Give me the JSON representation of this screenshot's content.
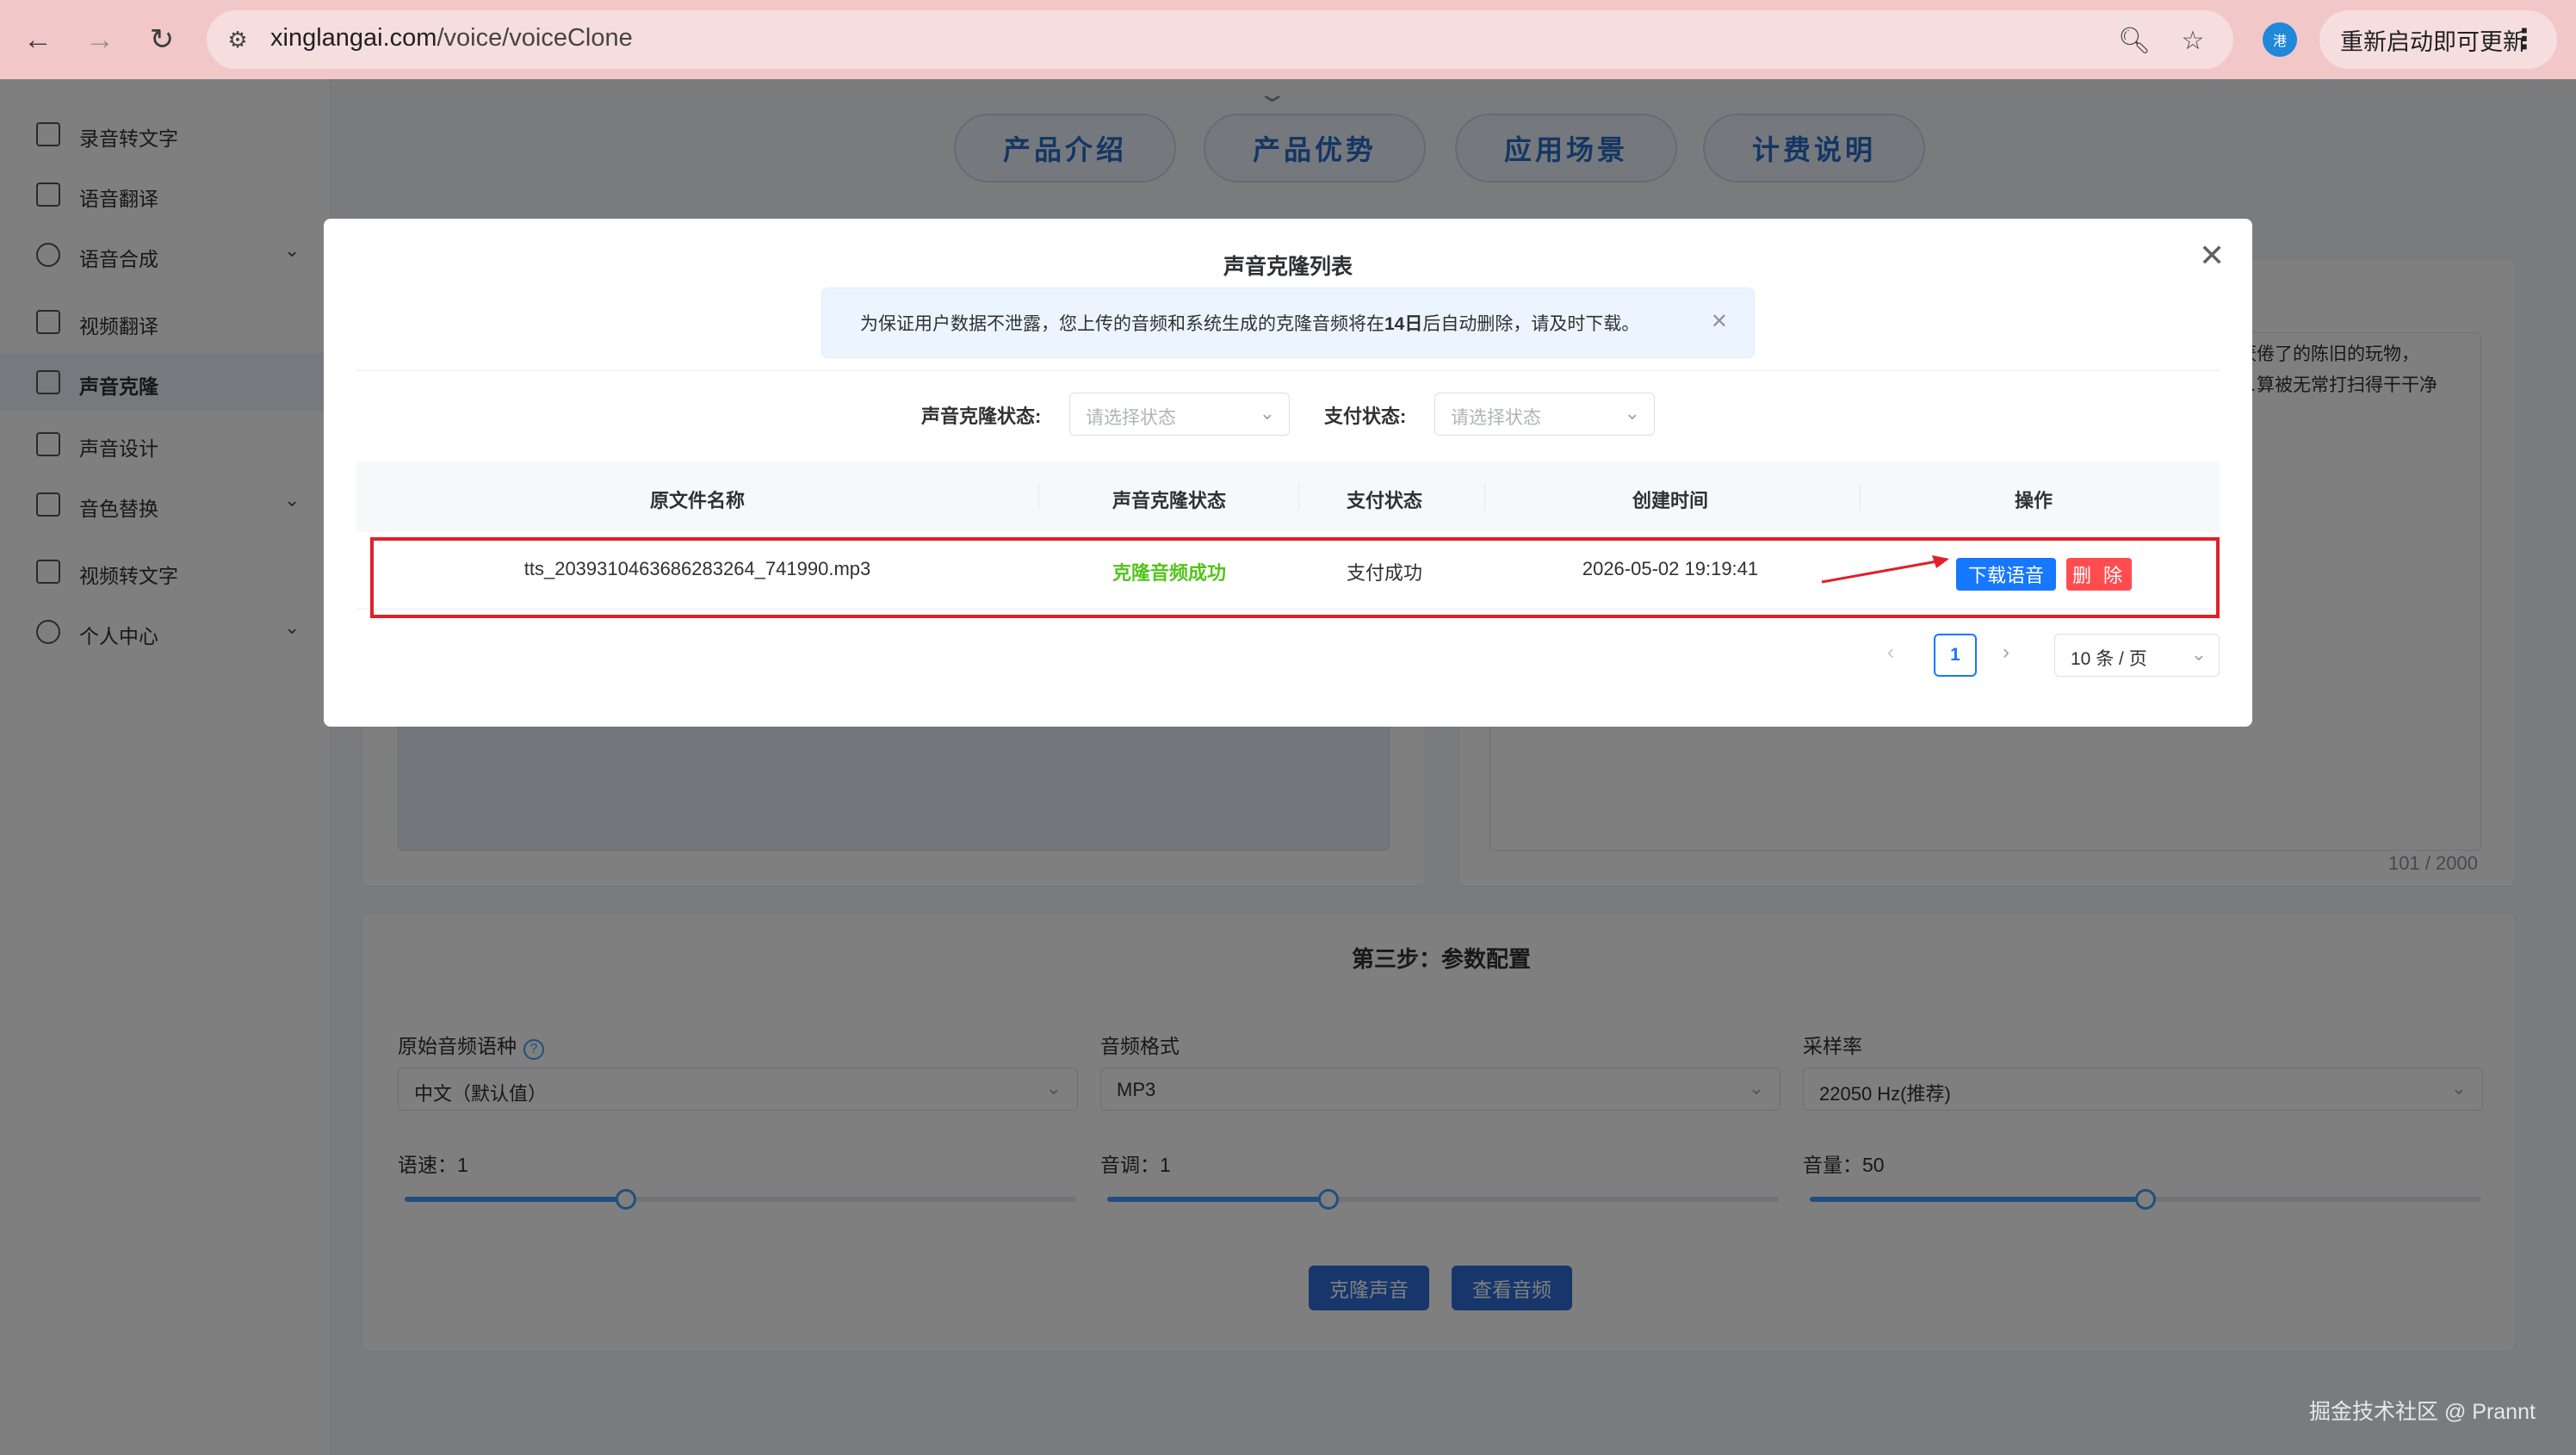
{
  "browser": {
    "url_domain": "xinglangai.com",
    "url_path": "/voice/voiceClone",
    "profile_initial": "港",
    "update_label": "重新启动即可更新"
  },
  "sidebar": {
    "items": [
      {
        "label": "录音转文字",
        "icon": "speaker-icon"
      },
      {
        "label": "语音翻译",
        "icon": "translate-icon"
      },
      {
        "label": "语音合成",
        "icon": "mic-icon",
        "expandable": true
      },
      {
        "label": "视频翻译",
        "icon": "video-play-icon"
      },
      {
        "label": "声音克隆",
        "icon": "copy-icon",
        "active": true
      },
      {
        "label": "声音设计",
        "icon": "sliders-icon"
      },
      {
        "label": "音色替换",
        "icon": "swap-icon",
        "expandable": true
      },
      {
        "label": "视频转文字",
        "icon": "video-camera-icon"
      },
      {
        "label": "个人中心",
        "icon": "user-icon",
        "expandable": true
      }
    ]
  },
  "top_tabs": [
    "产品介绍",
    "产品优势",
    "应用场景",
    "计费说明"
  ],
  "background": {
    "textarea_snippet": [
      "厌倦了的陈旧的玩物，",
      "…算被无常打扫得干干净"
    ],
    "char_counter": "101 / 2000",
    "step3_title": "第三步：参数配置",
    "params": {
      "language_label": "原始音频语种",
      "language_value": "中文（默认值）",
      "format_label": "音频格式",
      "format_value": "MP3",
      "rate_label": "采样率",
      "rate_value": "22050 Hz(推荐)",
      "speed_label": "语速：1",
      "pitch_label": "音调：1",
      "volume_label": "音量：50",
      "speed_fraction": 0.33,
      "pitch_fraction": 0.33,
      "volume_fraction": 0.5
    },
    "clone_button": "克隆声音",
    "view_button": "查看音频"
  },
  "dialog": {
    "title": "声音克隆列表",
    "alert_prefix": "为保证用户数据不泄露，您上传的音频和系统生成的克隆音频将在",
    "alert_days": "14日",
    "alert_suffix": "后自动删除，请及时下载。",
    "filters": {
      "clone_status_label": "声音克隆状态:",
      "clone_status_placeholder": "请选择状态",
      "pay_status_label": "支付状态:",
      "pay_status_placeholder": "请选择状态"
    },
    "columns": [
      "原文件名称",
      "声音克隆状态",
      "支付状态",
      "创建时间",
      "操作"
    ],
    "rows": [
      {
        "filename": "tts_2039310463686283264_741990.mp3",
        "clone_status": "克隆音频成功",
        "pay_status": "支付成功",
        "created": "2026-05-02 19:19:41",
        "download_label": "下载语音",
        "delete_label": "删 除"
      }
    ],
    "pagination": {
      "current_page": "1",
      "page_size": "10 条 / 页"
    }
  },
  "watermark": "掘金技术社区 @ Prannt",
  "colors": {
    "primary": "#1677ff",
    "danger": "#ff4d4f",
    "success": "#52c41a",
    "highlight_box": "#e0202a"
  }
}
